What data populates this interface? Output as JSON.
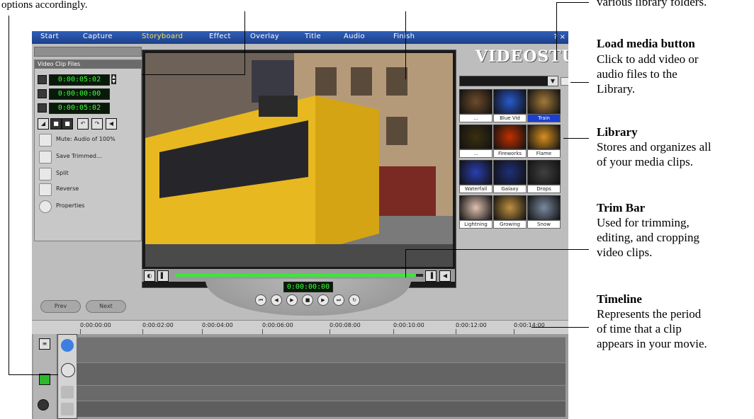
{
  "annotations": {
    "top_left_fragment": "options accordingly.",
    "top_right_fragment": "various library folders.",
    "load_media": {
      "title": "Load media button",
      "desc": "Click to add video or\naudio files to the\nLibrary."
    },
    "library": {
      "title": "Library",
      "desc": "Stores and organizes all\nof your media clips."
    },
    "trim_bar": {
      "title": "Trim Bar",
      "desc": "Used for trimming,\nediting, and cropping\nvideo clips."
    },
    "timeline": {
      "title": "Timeline",
      "desc": "Represents the period\nof time that a clip\nappears in your movie."
    }
  },
  "app": {
    "menu": [
      "Start",
      "Capture",
      "Storyboard",
      "Effect",
      "Overlay",
      "Title",
      "Audio",
      "Finish"
    ],
    "active_menu": "Storyboard",
    "window_buttons": "? ×",
    "logo": "VIDEOSTUDIO",
    "options_panel": {
      "header": "Video  Clip Files",
      "timecodes": [
        "0:00:05:02",
        "0:00:00:00",
        "0:00:05:02"
      ],
      "options": [
        "Mute: Audio of 100%",
        "Save Trimmed...",
        "Split",
        "Reverse",
        "Properties"
      ]
    },
    "nav_timecode": "0:00:00:00",
    "pills": [
      "Prev",
      "Next"
    ],
    "library_thumbs": [
      {
        "label": "...",
        "color": "#6e4b2a"
      },
      {
        "label": "Blue Vid",
        "color": "#2a5ad0"
      },
      {
        "label": "Train",
        "color": "#a37a3a",
        "selected": true
      },
      {
        "label": "...",
        "color": "#3a3010"
      },
      {
        "label": "Fireworks",
        "color": "#c03000"
      },
      {
        "label": "Flame",
        "color": "#d89020"
      },
      {
        "label": "Waterfall",
        "color": "#2a3fb0"
      },
      {
        "label": "Galaxy",
        "color": "#1f2f7a"
      },
      {
        "label": "Drops",
        "color": "#404040"
      },
      {
        "label": "Lightning",
        "color": "#e0c0b0"
      },
      {
        "label": "Growing",
        "color": "#c09040"
      },
      {
        "label": "Snow",
        "color": "#7a8aa0"
      }
    ],
    "ruler_ticks": [
      "0:00:00:00",
      "0:00:02:00",
      "0:00:04:00",
      "0:00:06:00",
      "0:00:08:00",
      "0:00:10:00",
      "0:00:12:00",
      "0:00:14:00"
    ]
  }
}
